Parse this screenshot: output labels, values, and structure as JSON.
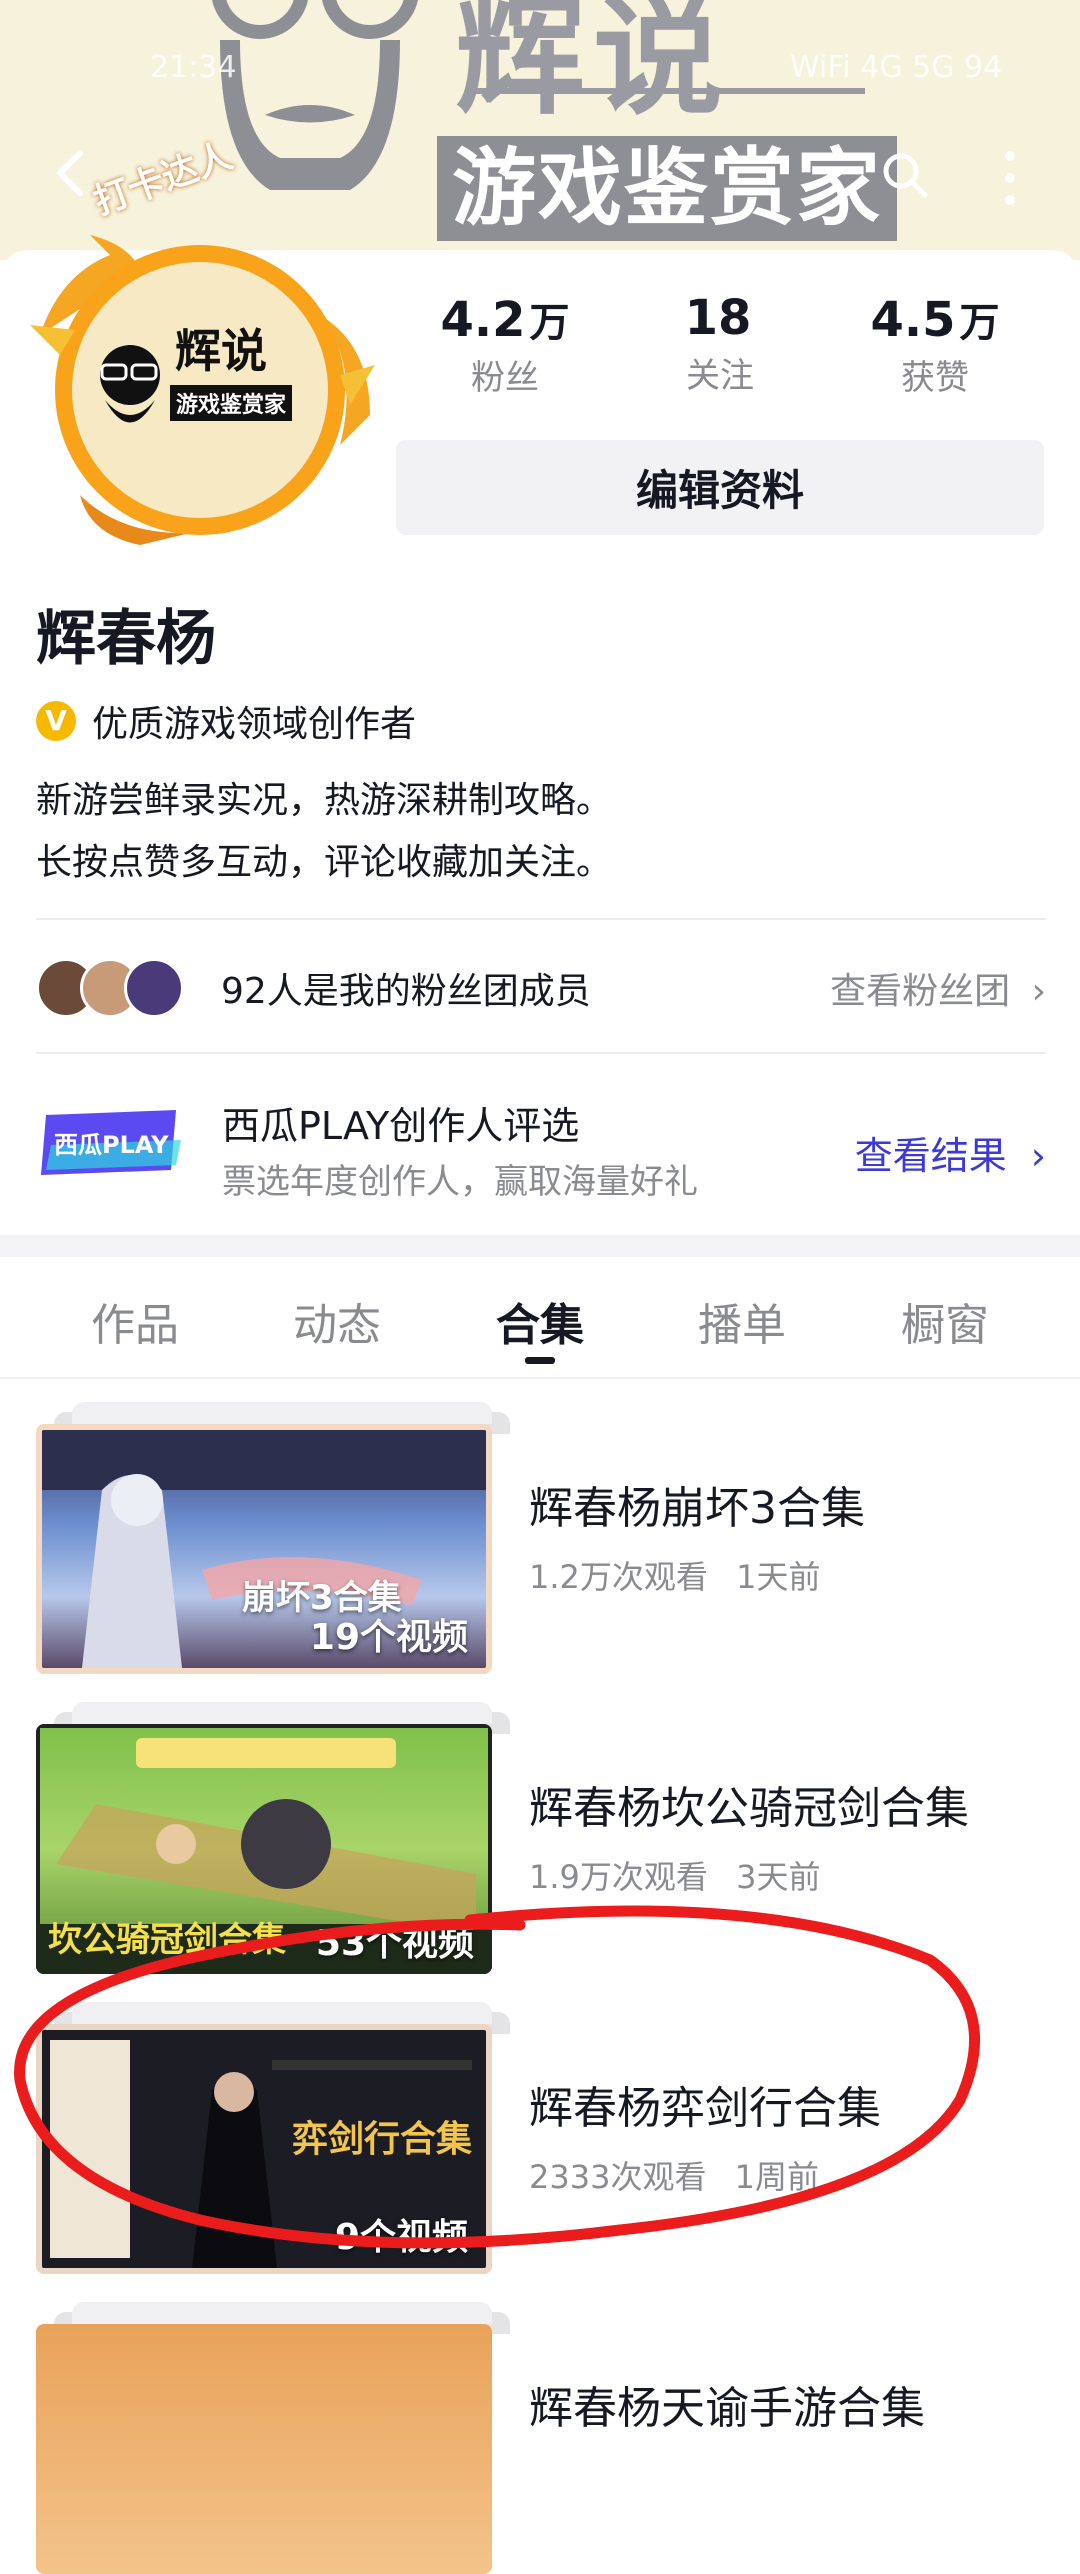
{
  "status_bar": {
    "time": "21:34",
    "icons": "WiFi 4G 5G 94"
  },
  "banner": {
    "big_title": "辉说",
    "subtitle": "游戏鉴赏家"
  },
  "avatar": {
    "badge_text": "打卡达人",
    "logo_title": "辉说",
    "logo_sub": "游戏鉴赏家"
  },
  "stats": [
    {
      "value": "4.2",
      "unit": "万",
      "label": "粉丝"
    },
    {
      "value": "18",
      "unit": "",
      "label": "关注"
    },
    {
      "value": "4.5",
      "unit": "万",
      "label": "获赞"
    }
  ],
  "edit_button": "编辑资料",
  "profile": {
    "name": "辉春杨",
    "certification": "优质游戏领域创作者",
    "bio_line1": "新游尝鲜录实况，热游深耕制攻略。",
    "bio_line2": "长按点赞多互动，评论收藏加关注。"
  },
  "fan_group": {
    "text": "92人是我的粉丝团成员",
    "link": "查看粉丝团"
  },
  "promo": {
    "logo_text": "西瓜PLAY",
    "title": "西瓜PLAY创作人评选",
    "subtitle": "票选年度创作人，赢取海量好礼",
    "link": "查看结果"
  },
  "tabs": [
    "作品",
    "动态",
    "合集",
    "播单",
    "橱窗"
  ],
  "active_tab": "合集",
  "collections": [
    {
      "title": "辉春杨崩坏3合集",
      "views": "1.2万次观看",
      "time": "1天前",
      "thumb_title": "崩坏3合集",
      "count": "19个视频"
    },
    {
      "title": "辉春杨坎公骑冠剑合集",
      "views": "1.9万次观看",
      "time": "3天前",
      "thumb_title": "坎公骑冠剑合集",
      "count": "53个视频"
    },
    {
      "title": "辉春杨弈剑行合集",
      "views": "2333次观看",
      "time": "1周前",
      "thumb_title": "弈剑行合集",
      "count": "9个视频"
    },
    {
      "title": "辉春杨天谕手游合集",
      "views": "",
      "time": "",
      "thumb_title": "",
      "count": ""
    }
  ]
}
